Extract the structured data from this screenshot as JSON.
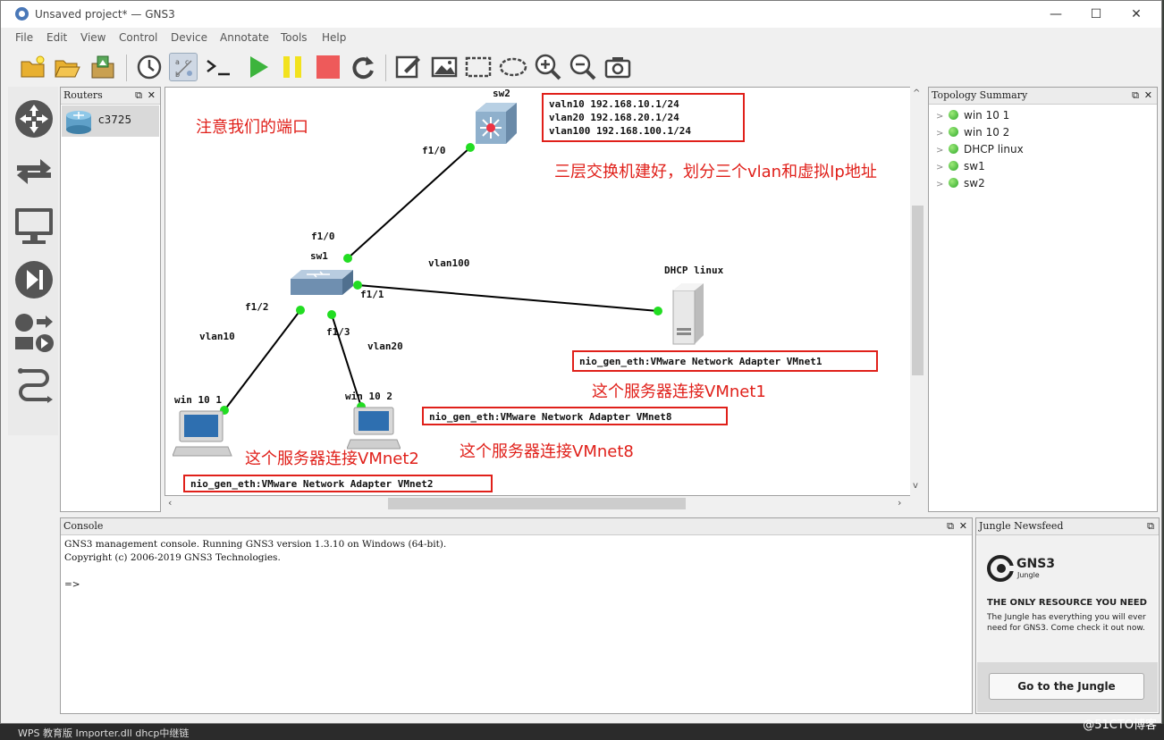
{
  "window": {
    "title": "Unsaved project* — GNS3",
    "controls": [
      "—",
      "☐",
      "✕"
    ]
  },
  "menu": [
    "File",
    "Edit",
    "View",
    "Control",
    "Device",
    "Annotate",
    "Tools",
    "Help"
  ],
  "toolbar": {
    "icons": [
      "new-project-icon",
      "open-project-icon",
      "save-project-icon",
      "snapshot-clock-icon",
      "show-interface-labels-icon",
      "console-icon",
      "start-all-icon",
      "suspend-all-icon",
      "stop-all-icon",
      "reload-all-icon",
      "add-note-icon",
      "insert-picture-icon",
      "draw-rectangle-icon",
      "draw-ellipse-icon",
      "zoom-in-icon",
      "zoom-out-icon",
      "screenshot-icon"
    ],
    "active": "show-interface-labels-icon"
  },
  "routers_panel": {
    "title": "Routers",
    "items": [
      {
        "label": "c3725",
        "icon": "router-icon"
      }
    ]
  },
  "canvas": {
    "nodes": {
      "sw2": "sw2",
      "sw1": "sw1",
      "dhcp": "DHCP linux",
      "win1": "win 10 1",
      "win2": "win 10 2"
    },
    "ports": {
      "sw2_f10": "f1/0",
      "sw1_f10": "f1/0",
      "sw1_f11": "f1/1",
      "sw1_f12": "f1/2",
      "sw1_f13": "f1/3"
    },
    "vlans": {
      "vlan100": "vlan100",
      "vlan10": "vlan10",
      "vlan20": "vlan20"
    },
    "vlan_box": [
      "valn10 192.168.10.1/24",
      "vlan20 192.168.20.1/24",
      "vlan100 192.168.100.1/24"
    ],
    "notes": {
      "ports_note": "注意我们的端口",
      "l3_note": "三层交换机建好，划分三个vlan和虚拟Ip地址",
      "vmnet1_note": "这个服务器连接VMnet1",
      "vmnet2_note": "这个服务器连接VMnet2",
      "vmnet8_note": "这个服务器连接VMnet8"
    },
    "nio": {
      "vmnet1": "nio_gen_eth:VMware Network Adapter VMnet1",
      "vmnet8": "nio_gen_eth:VMware Network Adapter VMnet8",
      "vmnet2": "nio_gen_eth:VMware Network Adapter VMnet2"
    },
    "link_color": "#000000",
    "port_dot_color": "#22dd22",
    "annotation_color": "#e0201a"
  },
  "topology_summary": {
    "title": "Topology Summary",
    "items": [
      "win 10 1",
      "win 10 2",
      "DHCP linux",
      "sw1",
      "sw2"
    ]
  },
  "console": {
    "title": "Console",
    "line1": "GNS3 management console. Running GNS3 version 1.3.10 on Windows (64-bit).",
    "line2": "Copyright (c) 2006-2019 GNS3 Technologies.",
    "prompt": "=>"
  },
  "newsfeed": {
    "title": "Jungle Newsfeed",
    "logo_text": "GNS3",
    "logo_sub": "Jungle",
    "headline": "THE ONLY RESOURCE YOU NEED",
    "body": "The Jungle has everything you will ever need for GNS3. Come check it out now.",
    "button": "Go to the Jungle"
  },
  "taskbar": {
    "text": "WPS 教育版   Importer.dll   dhcp中继链"
  },
  "watermark": "@51CTO博客"
}
